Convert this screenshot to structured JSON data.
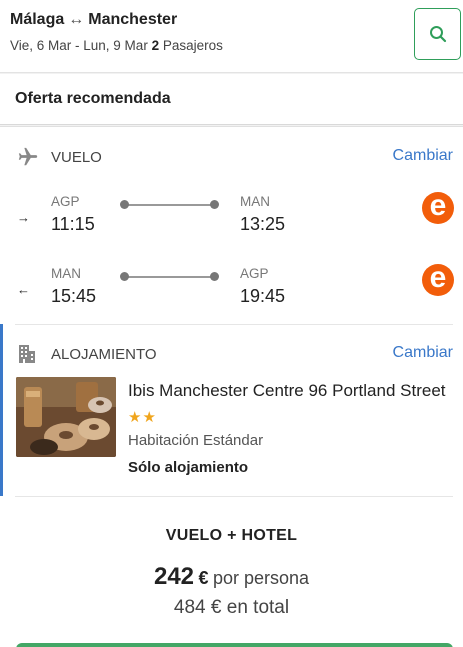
{
  "header": {
    "origin": "Málaga",
    "route_arrow": "↔",
    "destination": "Manchester",
    "dates": "Vie, 6 Mar - Lun, 9 Mar",
    "passengers_count": "2",
    "passengers_label": "Pasajeros"
  },
  "offer": {
    "title": "Oferta recomendada"
  },
  "flight": {
    "section_label": "VUELO",
    "change_label": "Cambiar",
    "legs": [
      {
        "direction": "→",
        "from_code": "AGP",
        "from_time": "11:15",
        "to_code": "MAN",
        "to_time": "13:25",
        "airline_logo": "e"
      },
      {
        "direction": "←",
        "from_code": "MAN",
        "from_time": "15:45",
        "to_code": "AGP",
        "to_time": "19:45",
        "airline_logo": "e"
      }
    ]
  },
  "hotel": {
    "section_label": "ALOJAMIENTO",
    "change_label": "Cambiar",
    "name": "Ibis Manchester Centre 96 Portland Street",
    "stars": "★★",
    "room": "Habitación Estándar",
    "board": "Sólo alojamiento"
  },
  "summary": {
    "title": "VUELO + HOTEL",
    "price_per_person": "242",
    "currency": "€",
    "per_person_label": "por persona",
    "total_price": "484",
    "total_label": "en total"
  },
  "colors": {
    "accent_green": "#2f9e5a",
    "link_blue": "#3a78c9",
    "airline_orange": "#f25d0a",
    "star_gold": "#f0a51d"
  }
}
